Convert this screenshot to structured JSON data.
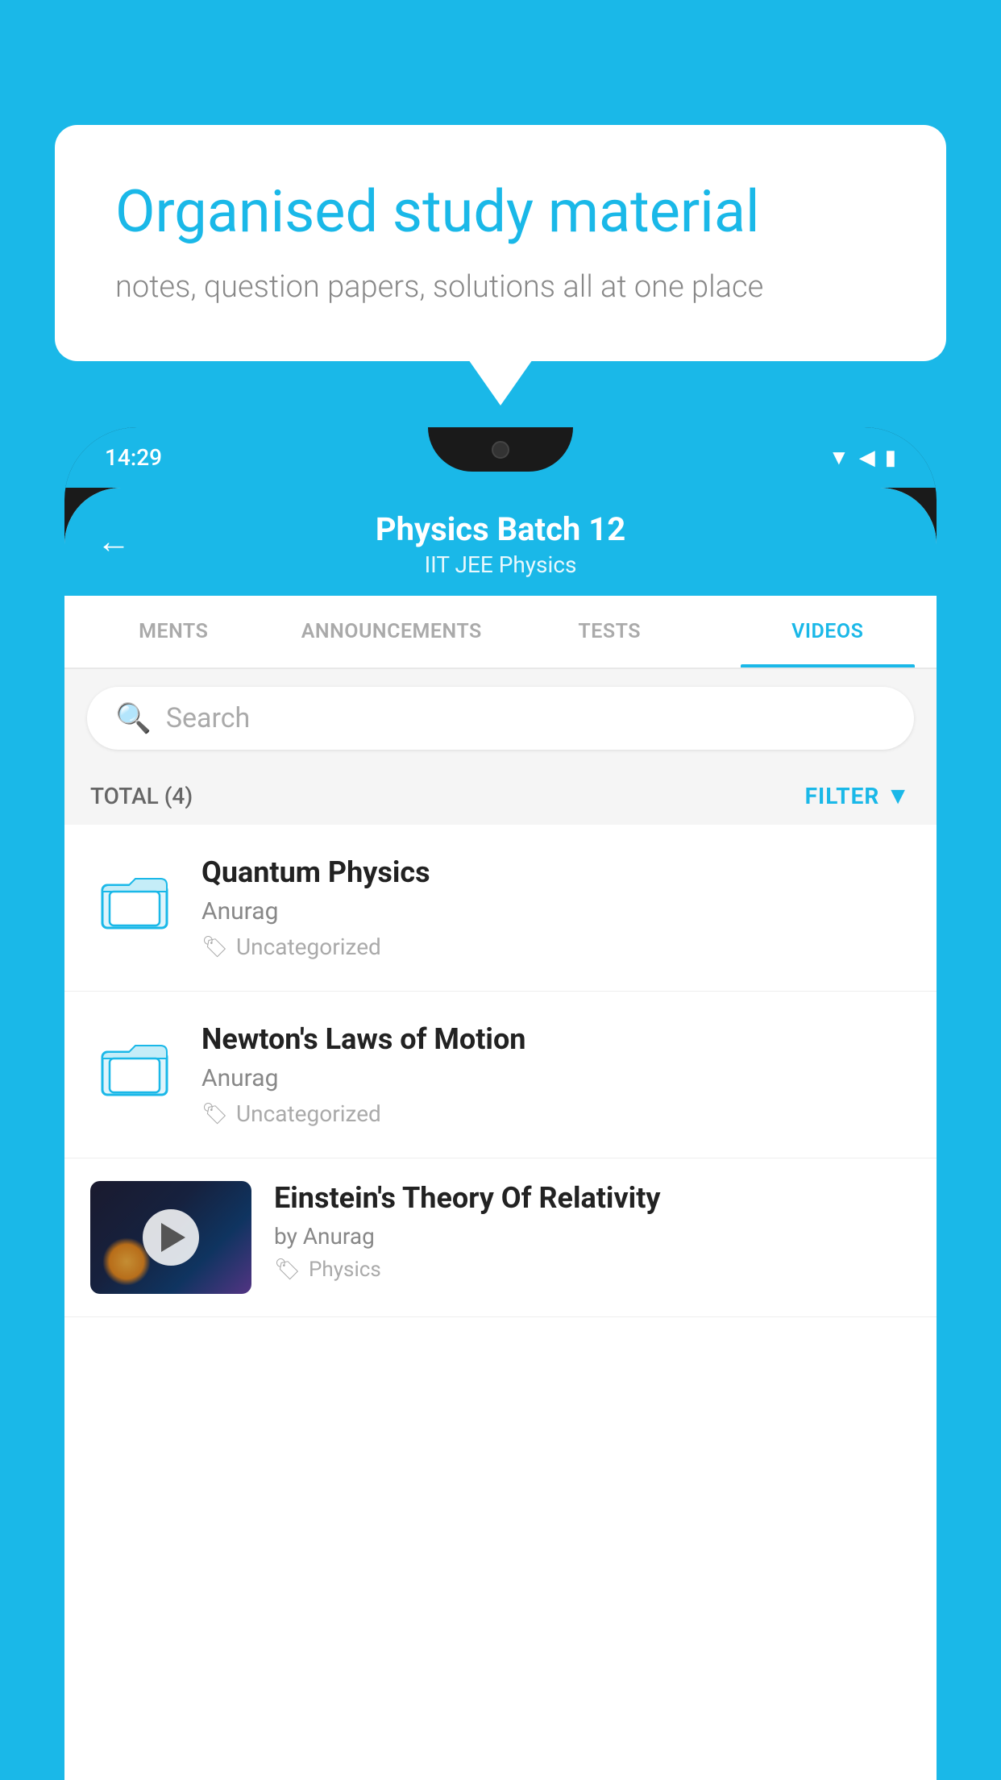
{
  "background": {
    "color": "#1ab8e8"
  },
  "speech_bubble": {
    "title": "Organised study material",
    "subtitle": "notes, question papers, solutions all at one place"
  },
  "phone": {
    "status_bar": {
      "time": "14:29"
    },
    "header": {
      "title": "Physics Batch 12",
      "subtitle": "IIT JEE   Physics",
      "back_label": "←"
    },
    "tabs": [
      {
        "label": "MENTS",
        "active": false
      },
      {
        "label": "ANNOUNCEMENTS",
        "active": false
      },
      {
        "label": "TESTS",
        "active": false
      },
      {
        "label": "VIDEOS",
        "active": true
      }
    ],
    "search": {
      "placeholder": "Search"
    },
    "filter_bar": {
      "total_label": "TOTAL (4)",
      "filter_label": "FILTER"
    },
    "videos": [
      {
        "title": "Quantum Physics",
        "author": "Anurag",
        "tag": "Uncategorized",
        "type": "folder"
      },
      {
        "title": "Newton's Laws of Motion",
        "author": "Anurag",
        "tag": "Uncategorized",
        "type": "folder"
      },
      {
        "title": "Einstein's Theory Of Relativity",
        "author": "by Anurag",
        "tag": "Physics",
        "type": "video"
      }
    ]
  }
}
